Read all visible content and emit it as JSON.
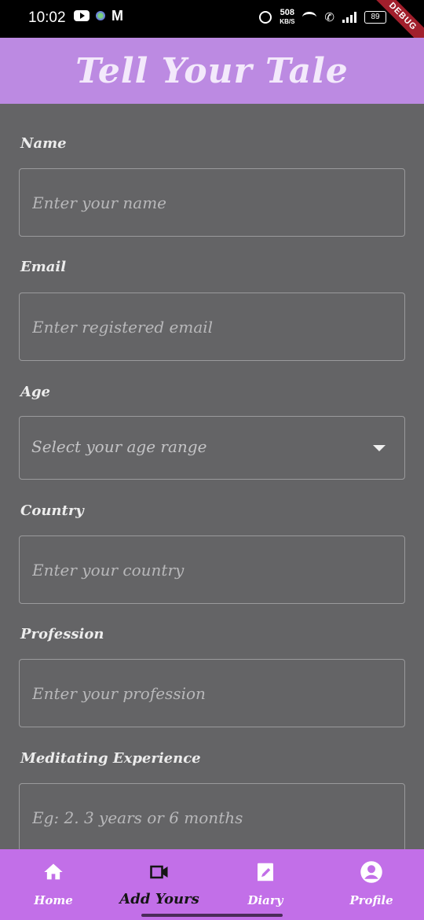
{
  "status_bar": {
    "time": "10:02",
    "speed_value": "508",
    "speed_unit": "KB/S",
    "battery": "89",
    "debug_label": "DEBUG"
  },
  "app_bar": {
    "title": "Tell Your Tale"
  },
  "form": {
    "name": {
      "label": "Name",
      "placeholder": "Enter your name",
      "value": ""
    },
    "email": {
      "label": "Email",
      "placeholder": "Enter registered email",
      "value": ""
    },
    "age": {
      "label": "Age",
      "placeholder": "Select your age range"
    },
    "country": {
      "label": "Country",
      "placeholder": "Enter your country",
      "value": ""
    },
    "profession": {
      "label": "Profession",
      "placeholder": "Enter your profession",
      "value": ""
    },
    "experience": {
      "label": "Meditating Experience",
      "placeholder": "Eg: 2. 3 years or 6 months",
      "value": ""
    }
  },
  "bottom_nav": {
    "items": [
      {
        "label": "Home",
        "icon": "home-icon"
      },
      {
        "label": "Add Yours",
        "icon": "video-camera-icon"
      },
      {
        "label": "Diary",
        "icon": "clipboard-edit-icon"
      },
      {
        "label": "Profile",
        "icon": "account-circle-icon"
      }
    ],
    "active_index": 1
  },
  "colors": {
    "app_bar": "#bc8ae2",
    "background": "#646466",
    "bottom_nav": "#c26fe8"
  }
}
